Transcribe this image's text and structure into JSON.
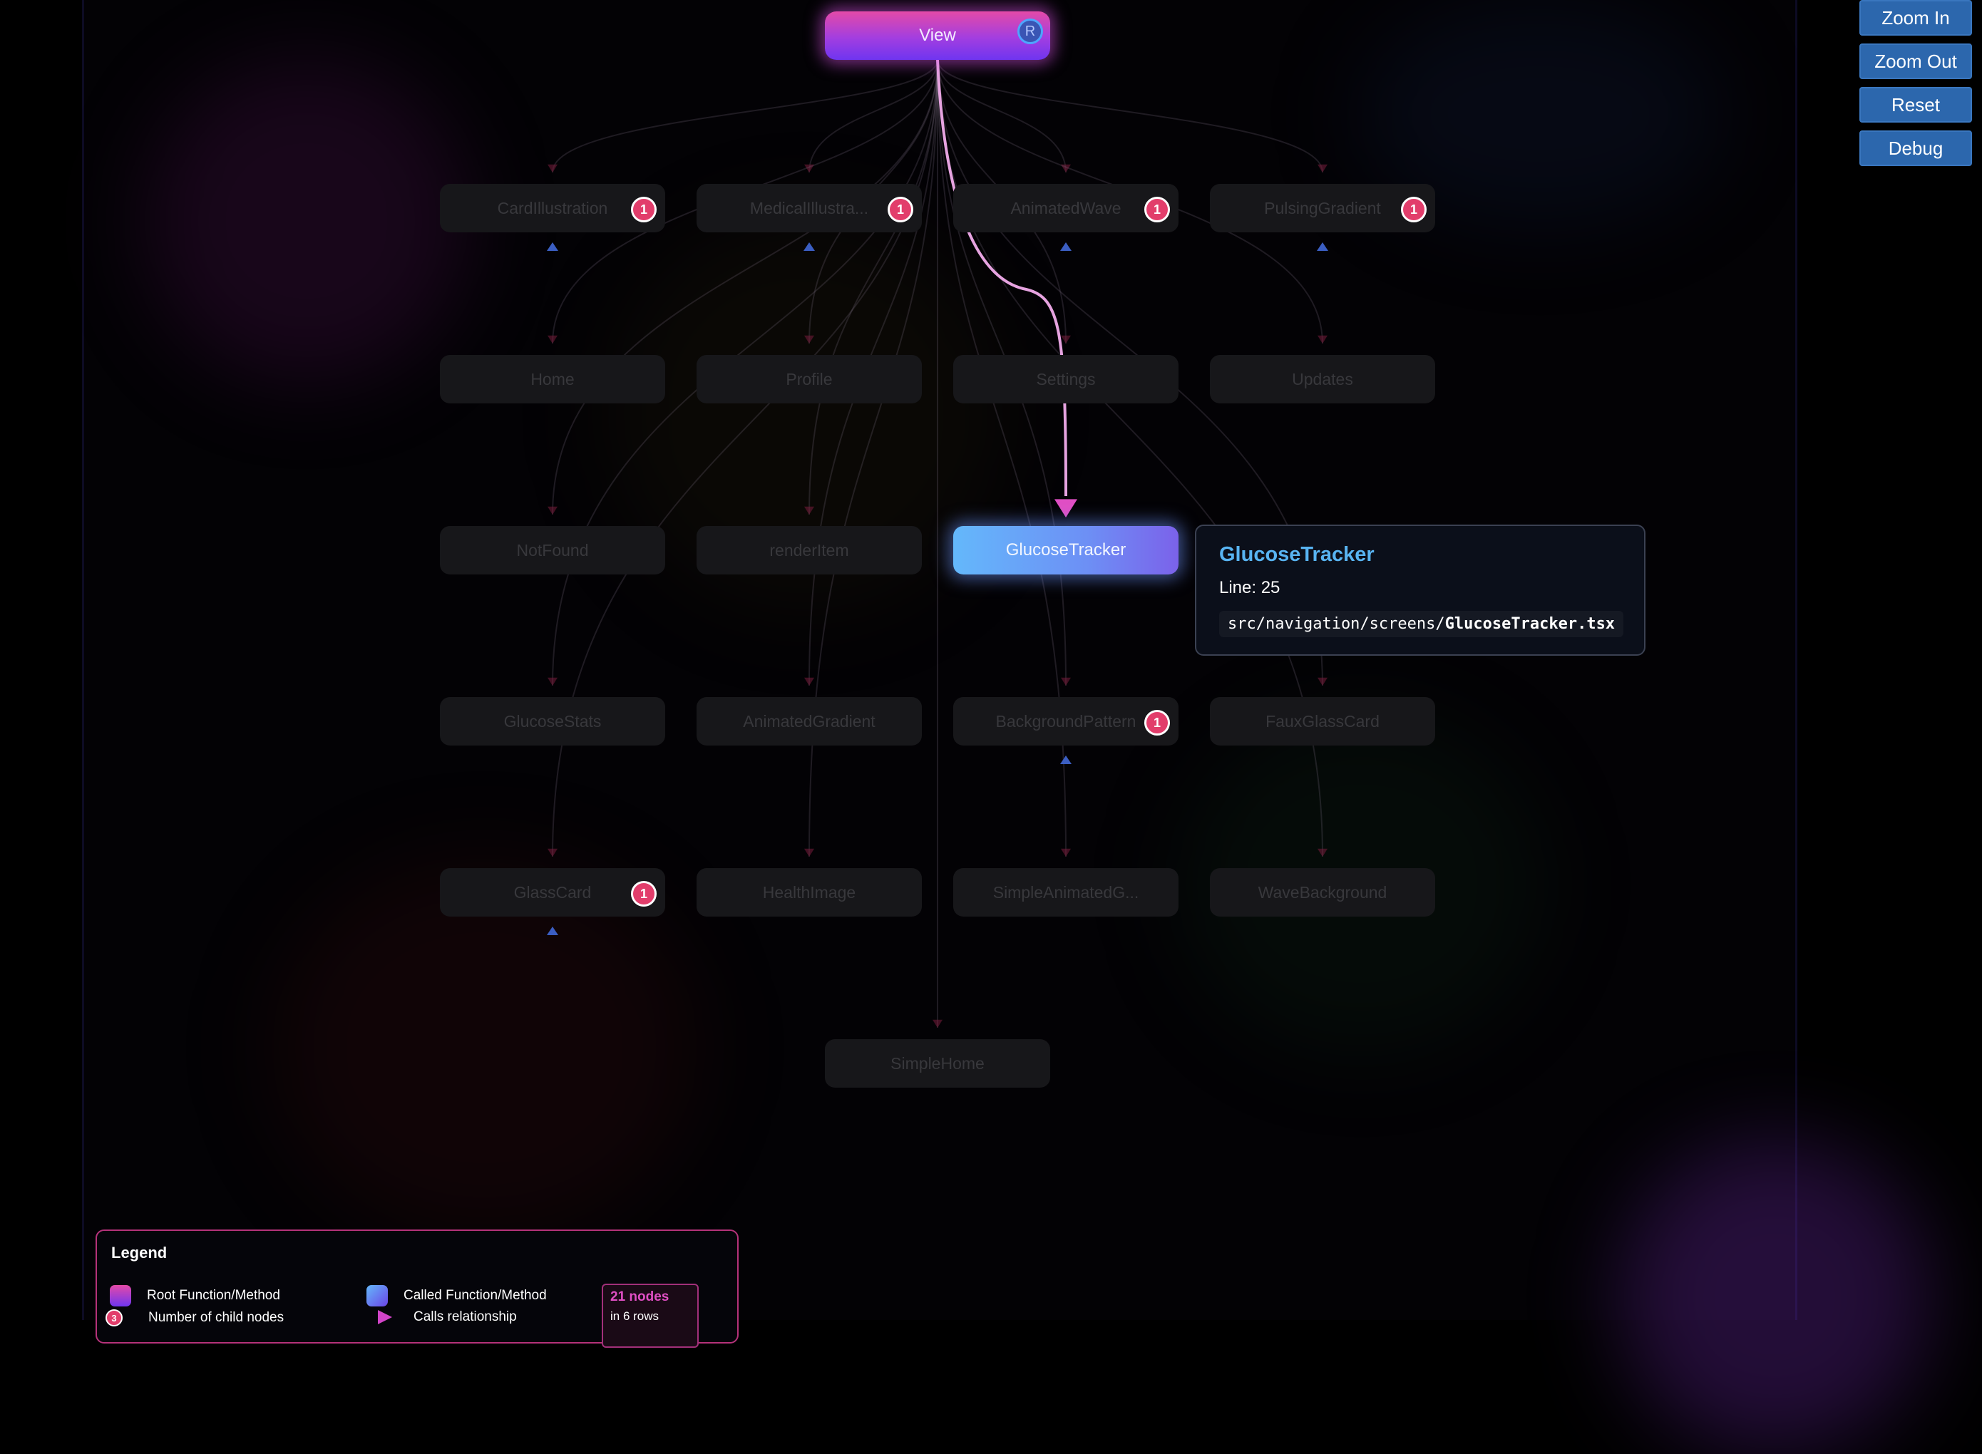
{
  "controls": {
    "zoom_in": "Zoom In",
    "zoom_out": "Zoom Out",
    "reset": "Reset",
    "debug": "Debug"
  },
  "graph": {
    "root": {
      "label": "View",
      "badge": "R"
    },
    "rows": [
      [
        {
          "label": "CardIllustration",
          "badge": "1"
        },
        {
          "label": "MedicalIllustra...",
          "badge": "1"
        },
        {
          "label": "AnimatedWave",
          "badge": "1"
        },
        {
          "label": "PulsingGradient",
          "badge": "1"
        }
      ],
      [
        {
          "label": "Home"
        },
        {
          "label": "Profile"
        },
        {
          "label": "Settings"
        },
        {
          "label": "Updates"
        }
      ],
      [
        {
          "label": "NotFound"
        },
        {
          "label": "renderItem"
        },
        {
          "label": "GlucoseTracker",
          "active": true
        }
      ],
      [
        {
          "label": "GlucoseStats"
        },
        {
          "label": "AnimatedGradient"
        },
        {
          "label": "BackgroundPattern",
          "badge": "1"
        },
        {
          "label": "FauxGlassCard"
        }
      ],
      [
        {
          "label": "GlassCard",
          "badge": "1"
        },
        {
          "label": "HealthImage"
        },
        {
          "label": "SimpleAnimatedG..."
        },
        {
          "label": "WaveBackground"
        }
      ],
      [
        {
          "label": "SimpleHome"
        }
      ]
    ]
  },
  "tooltip": {
    "title": "GlucoseTracker",
    "line": "Line: 25",
    "path_prefix": "src/navigation/screens/",
    "path_file": "GlucoseTracker.tsx"
  },
  "legend": {
    "title": "Legend",
    "root_label": "Root Function/Method",
    "called_label": "Called Function/Method",
    "child_badge": "3",
    "child_label": "Number of child nodes",
    "calls_label": "Calls relationship",
    "node_count": "21 nodes",
    "row_count": "in 6 rows"
  },
  "colors": {
    "background": "#000000",
    "root_gradient_start": "#e44aa8",
    "root_gradient_end": "#6f35f0",
    "active_gradient_start": "#64b8fb",
    "active_gradient_end": "#7b62ea",
    "badge": "#e23d6b",
    "highlight_edge": "#e04fc4",
    "control_button": "#2c67ad",
    "tooltip_title": "#58b4f2"
  }
}
